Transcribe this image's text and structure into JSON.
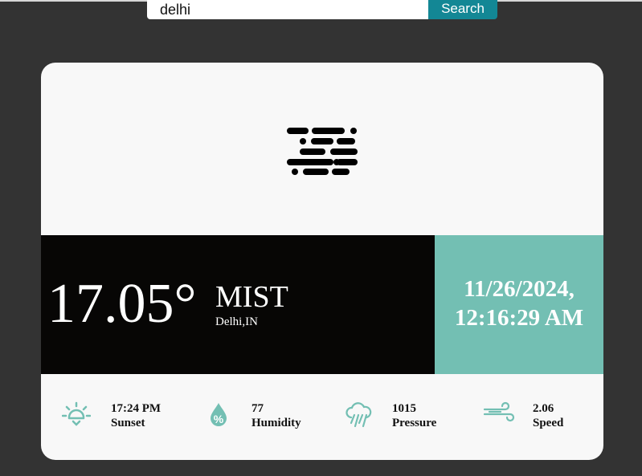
{
  "search": {
    "value": "delhi",
    "button_label": "Search"
  },
  "weather": {
    "condition_icon": "mist-icon",
    "temperature": "17.05°",
    "condition": "MIST",
    "location": "Delhi,IN",
    "date": "11/26/2024,",
    "time": "12:16:29 AM"
  },
  "stats": [
    {
      "icon": "sunset-icon",
      "value": "17:24 PM",
      "label": "Sunset"
    },
    {
      "icon": "humidity-icon",
      "value": "77",
      "label": "Humidity"
    },
    {
      "icon": "pressure-icon",
      "value": "1015",
      "label": "Pressure"
    },
    {
      "icon": "wind-icon",
      "value": "2.06",
      "label": "Speed"
    }
  ],
  "colors": {
    "background": "#333333",
    "card": "#f8f8f8",
    "temperature_band": "#070605",
    "date_band": "#73bfb3",
    "accent": "#73bfb3",
    "search_button": "#138795"
  }
}
